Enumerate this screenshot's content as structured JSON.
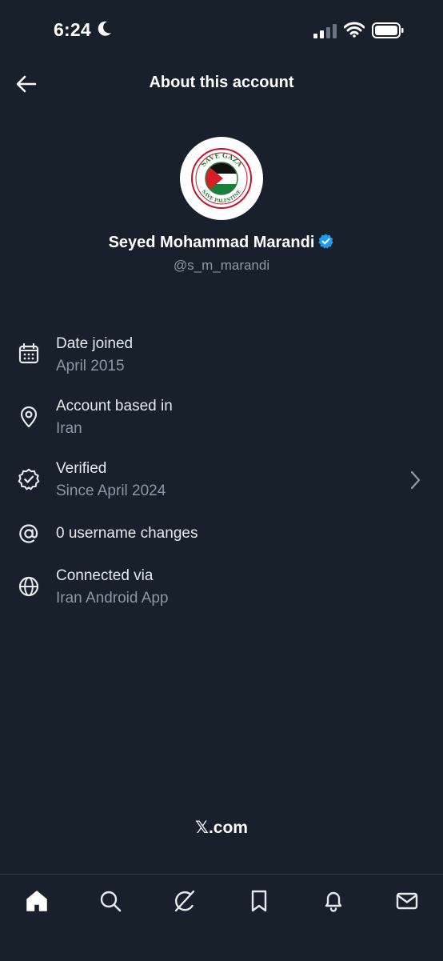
{
  "status_bar": {
    "time": "6:24"
  },
  "header": {
    "title": "About this account"
  },
  "profile": {
    "name": "Seyed Mohammad Marandi",
    "handle": "@s_m_marandi",
    "avatar_top_text": "SAVE GAZA",
    "avatar_bottom_text": "SAVE PALESTINE"
  },
  "info": [
    {
      "icon": "calendar-icon",
      "label": "Date joined",
      "value": "April 2015"
    },
    {
      "icon": "location-pin-icon",
      "label": "Account based in",
      "value": "Iran"
    },
    {
      "icon": "verified-badge-icon",
      "label": "Verified",
      "value": "Since April 2024"
    },
    {
      "icon": "at-sign-icon",
      "label": "0 username changes"
    },
    {
      "icon": "globe-icon",
      "label": "Connected via",
      "value": "Iran Android App"
    }
  ],
  "footer": {
    "logo_x": "𝕏",
    "logo_text": ".com"
  },
  "colors": {
    "background": "#17202b",
    "verified_blue": "#1d9bf0",
    "secondary_text": "#8b98a5"
  },
  "tabs": [
    "home-icon",
    "search-icon",
    "grok-icon",
    "bookmark-icon",
    "notifications-icon",
    "messages-icon"
  ]
}
